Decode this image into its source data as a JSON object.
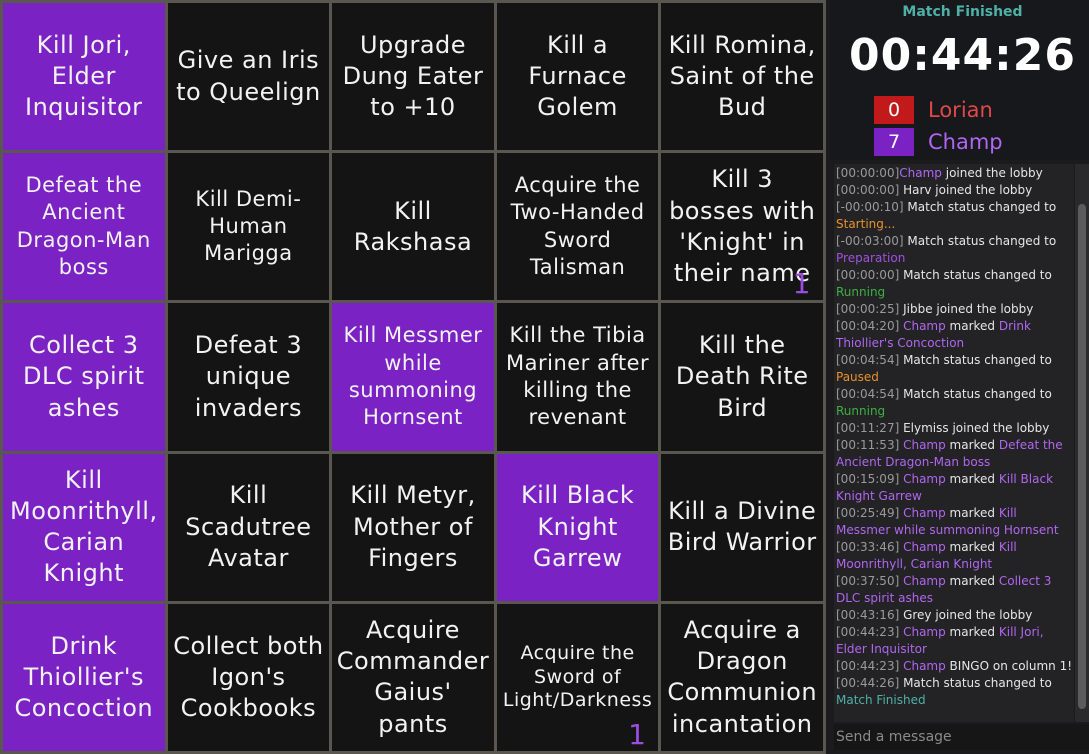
{
  "board": {
    "cells": [
      {
        "text": "Kill Jori, Elder Inquisitor",
        "marked": true,
        "mark": "",
        "size": ""
      },
      {
        "text": "Give an Iris to Queelign",
        "marked": false,
        "mark": "",
        "size": ""
      },
      {
        "text": "Upgrade Dung Eater to +10",
        "marked": false,
        "mark": "",
        "size": ""
      },
      {
        "text": "Kill a Furnace Golem",
        "marked": false,
        "mark": "",
        "size": ""
      },
      {
        "text": "Kill Romina, Saint of the Bud",
        "marked": false,
        "mark": "",
        "size": ""
      },
      {
        "text": "Defeat the Ancient Dragon-Man boss",
        "marked": true,
        "mark": "",
        "size": "small"
      },
      {
        "text": "Kill Demi-Human Marigga",
        "marked": false,
        "mark": "",
        "size": "small"
      },
      {
        "text": "Kill Rakshasa",
        "marked": false,
        "mark": "",
        "size": ""
      },
      {
        "text": "Acquire the Two-Handed Sword Talisman",
        "marked": false,
        "mark": "",
        "size": "small"
      },
      {
        "text": "Kill 3 bosses with 'Knight' in their name",
        "marked": false,
        "mark": "1",
        "size": ""
      },
      {
        "text": "Collect 3 DLC spirit ashes",
        "marked": true,
        "mark": "",
        "size": ""
      },
      {
        "text": "Defeat 3 unique invaders",
        "marked": false,
        "mark": "",
        "size": ""
      },
      {
        "text": "Kill Messmer while summoning Hornsent",
        "marked": true,
        "mark": "",
        "size": "small"
      },
      {
        "text": "Kill the Tibia Mariner after killing the revenant",
        "marked": false,
        "mark": "",
        "size": "small"
      },
      {
        "text": "Kill the Death Rite Bird",
        "marked": false,
        "mark": "",
        "size": ""
      },
      {
        "text": "Kill Moonrithyll, Carian Knight",
        "marked": true,
        "mark": "",
        "size": ""
      },
      {
        "text": "Kill Scadutree Avatar",
        "marked": false,
        "mark": "",
        "size": ""
      },
      {
        "text": "Kill Metyr, Mother of Fingers",
        "marked": false,
        "mark": "",
        "size": ""
      },
      {
        "text": "Kill Black Knight Garrew",
        "marked": true,
        "mark": "",
        "size": ""
      },
      {
        "text": "Kill a Divine Bird Warrior",
        "marked": false,
        "mark": "",
        "size": ""
      },
      {
        "text": "Drink Thiollier's Concoction",
        "marked": true,
        "mark": "",
        "size": ""
      },
      {
        "text": "Collect both Igon's Cookbooks",
        "marked": false,
        "mark": "",
        "size": ""
      },
      {
        "text": "Acquire Commander Gaius' pants",
        "marked": false,
        "mark": "",
        "size": ""
      },
      {
        "text": "Acquire the Sword of Light/Darkness",
        "marked": false,
        "mark": "1",
        "size": "xsmall"
      },
      {
        "text": "Acquire a Dragon Communion incantation",
        "marked": false,
        "mark": "",
        "size": ""
      }
    ]
  },
  "status": {
    "label": "Match Finished",
    "timer": "00:44:26"
  },
  "teams": [
    {
      "score": "0",
      "name": "Lorian",
      "color": "#c21a1a",
      "text_color": "#e04848"
    },
    {
      "score": "7",
      "name": "Champ",
      "color": "#7b22c4",
      "text_color": "#b066f0"
    }
  ],
  "log": [
    {
      "time": "[00:00:00]",
      "parts": [
        {
          "t": "Champ",
          "c": "player"
        },
        {
          "t": " joined the lobby",
          "c": ""
        }
      ]
    },
    {
      "time": "[00:00:00]",
      "parts": [
        {
          "t": " Harv joined the lobby",
          "c": ""
        }
      ]
    },
    {
      "time": "[-00:00:10]",
      "parts": [
        {
          "t": " Match status changed to ",
          "c": ""
        },
        {
          "t": "Starting...",
          "c": "st-starting"
        }
      ]
    },
    {
      "time": "[-00:03:00]",
      "parts": [
        {
          "t": " Match status changed to ",
          "c": ""
        },
        {
          "t": "Preparation",
          "c": "st-prep"
        }
      ]
    },
    {
      "time": "[00:00:00]",
      "parts": [
        {
          "t": " Match status changed to ",
          "c": ""
        },
        {
          "t": "Running",
          "c": "st-running"
        }
      ]
    },
    {
      "time": "[00:00:25]",
      "parts": [
        {
          "t": " Jibbe joined the lobby",
          "c": ""
        }
      ]
    },
    {
      "time": "[00:04:20]",
      "parts": [
        {
          "t": " Champ",
          "c": "player"
        },
        {
          "t": " marked ",
          "c": ""
        },
        {
          "t": "Drink Thiollier's Concoction",
          "c": "goal"
        }
      ]
    },
    {
      "time": "[00:04:54]",
      "parts": [
        {
          "t": " Match status changed to ",
          "c": ""
        },
        {
          "t": "Paused",
          "c": "st-paused"
        }
      ]
    },
    {
      "time": "[00:04:54]",
      "parts": [
        {
          "t": " Match status changed to ",
          "c": ""
        },
        {
          "t": "Running",
          "c": "st-running"
        }
      ]
    },
    {
      "time": "[00:11:27]",
      "parts": [
        {
          "t": " Elymiss joined the lobby",
          "c": ""
        }
      ]
    },
    {
      "time": "[00:11:53]",
      "parts": [
        {
          "t": " Champ",
          "c": "player"
        },
        {
          "t": " marked ",
          "c": ""
        },
        {
          "t": "Defeat the Ancient Dragon-Man boss",
          "c": "goal"
        }
      ]
    },
    {
      "time": "[00:15:09]",
      "parts": [
        {
          "t": " Champ",
          "c": "player"
        },
        {
          "t": " marked ",
          "c": ""
        },
        {
          "t": "Kill Black Knight Garrew",
          "c": "goal"
        }
      ]
    },
    {
      "time": "[00:25:49]",
      "parts": [
        {
          "t": " Champ",
          "c": "player"
        },
        {
          "t": " marked ",
          "c": ""
        },
        {
          "t": "Kill Messmer while summoning Hornsent",
          "c": "goal"
        }
      ]
    },
    {
      "time": "[00:33:46]",
      "parts": [
        {
          "t": " Champ",
          "c": "player"
        },
        {
          "t": " marked ",
          "c": ""
        },
        {
          "t": "Kill Moonrithyll, Carian Knight",
          "c": "goal"
        }
      ]
    },
    {
      "time": "[00:37:50]",
      "parts": [
        {
          "t": " Champ",
          "c": "player"
        },
        {
          "t": " marked ",
          "c": ""
        },
        {
          "t": "Collect 3 DLC spirit ashes",
          "c": "goal"
        }
      ]
    },
    {
      "time": "[00:43:16]",
      "parts": [
        {
          "t": " Grey joined the lobby",
          "c": ""
        }
      ]
    },
    {
      "time": "[00:44:23]",
      "parts": [
        {
          "t": " Champ",
          "c": "player"
        },
        {
          "t": " marked ",
          "c": ""
        },
        {
          "t": "Kill Jori, Elder Inquisitor",
          "c": "goal"
        }
      ]
    },
    {
      "time": "[00:44:23]",
      "parts": [
        {
          "t": " Champ",
          "c": "player"
        },
        {
          "t": " BINGO on column 1!",
          "c": ""
        }
      ]
    },
    {
      "time": "[00:44:26]",
      "parts": [
        {
          "t": " Match status changed to ",
          "c": ""
        },
        {
          "t": "Match Finished",
          "c": "st-finished"
        }
      ]
    }
  ],
  "chat": {
    "placeholder": "Send a message"
  }
}
